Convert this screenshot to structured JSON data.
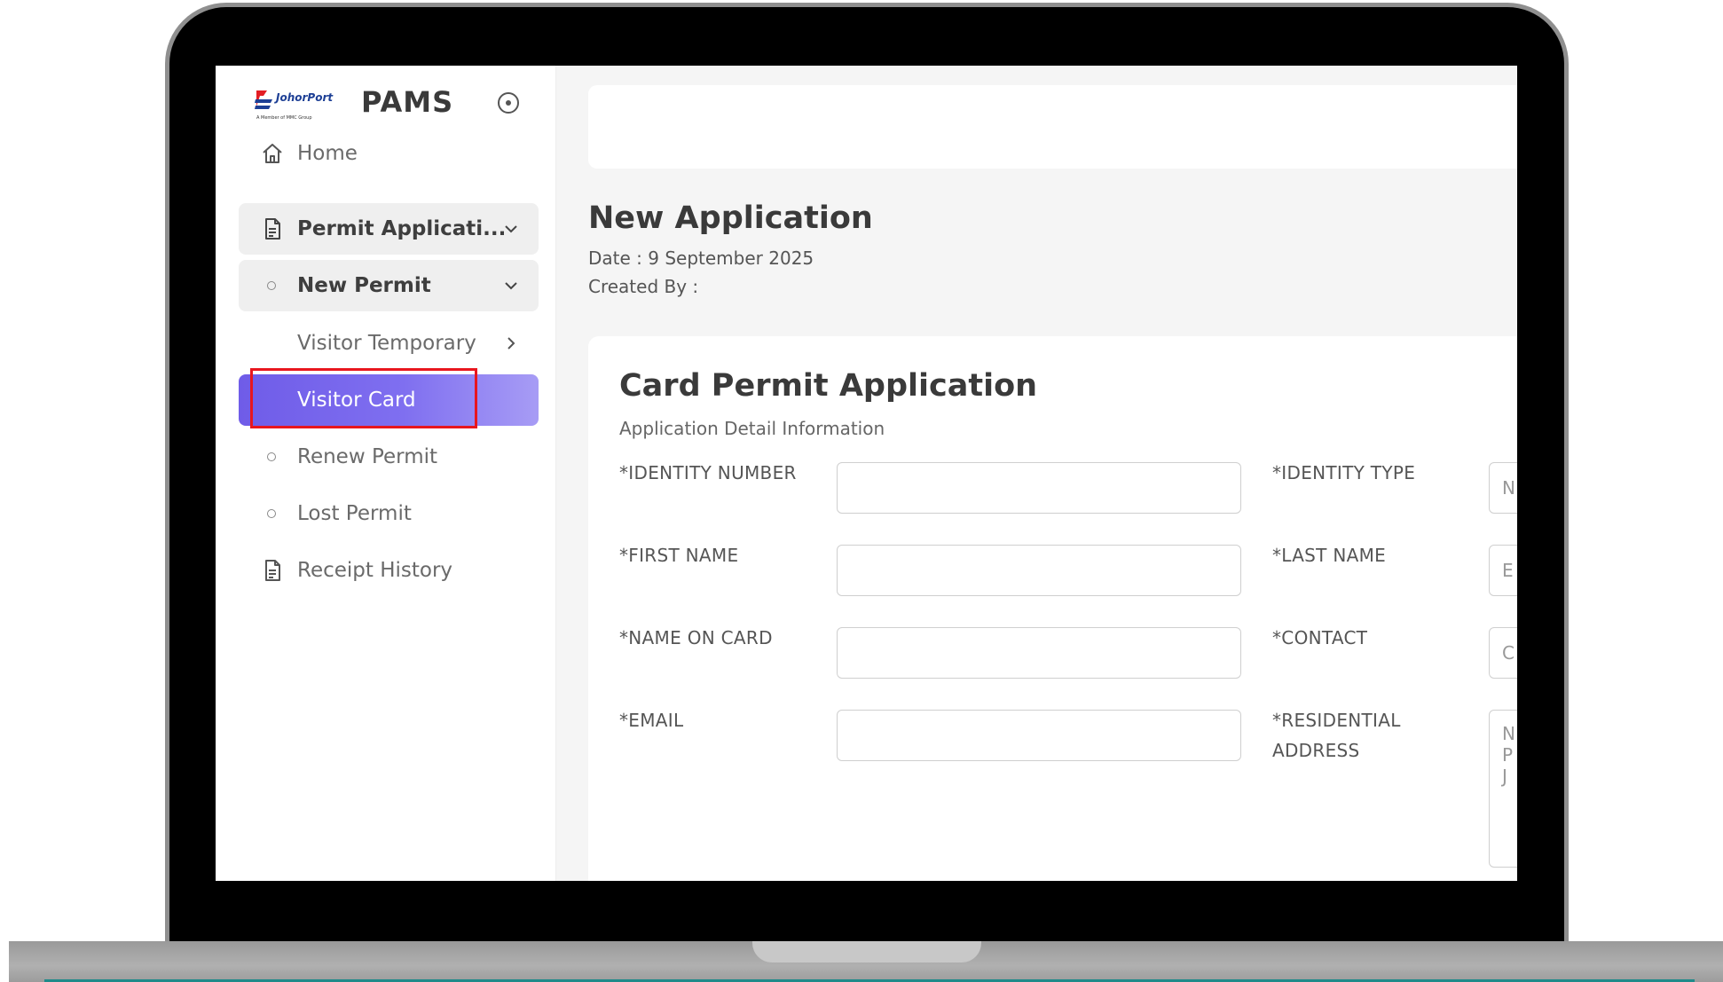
{
  "app": {
    "brand": "PAMS",
    "logo_text": "JohorPort",
    "logo_sub": "A Member of MMC Group"
  },
  "sidebar": {
    "items": [
      {
        "label": "Home",
        "icon": "home-icon"
      },
      {
        "label": "Permit Applicati...",
        "icon": "document-icon"
      },
      {
        "label": "New Permit",
        "icon": "circle-bullet-icon"
      },
      {
        "label": "Visitor Temporary",
        "icon": "chevron-right-icon"
      },
      {
        "label": "Visitor Card",
        "icon": ""
      },
      {
        "label": "Renew Permit",
        "icon": "circle-bullet-icon"
      },
      {
        "label": "Lost Permit",
        "icon": "circle-bullet-icon"
      },
      {
        "label": "Receipt History",
        "icon": "document-icon"
      }
    ]
  },
  "header": {
    "title": "New Application",
    "date": "Date : 9 September 2025",
    "created_by": "Created By :"
  },
  "form": {
    "title": "Card Permit Application",
    "subtitle": "Application Detail Information",
    "fields": {
      "identity_number": {
        "label": "*IDENTITY NUMBER",
        "value": ""
      },
      "identity_type": {
        "label": "*IDENTITY TYPE",
        "placeholder": "N"
      },
      "first_name": {
        "label": "*FIRST NAME",
        "value": ""
      },
      "last_name": {
        "label": "*LAST NAME",
        "placeholder": "E"
      },
      "name_on_card": {
        "label": "*NAME ON CARD",
        "value": ""
      },
      "contact": {
        "label": "*CONTACT",
        "placeholder": "C"
      },
      "email": {
        "label": "*EMAIL",
        "value": ""
      },
      "residential_address": {
        "label_line1": "*RESIDENTIAL",
        "label_line2": "ADDRESS",
        "placeholder": "N\nP\nJ"
      }
    }
  },
  "colors": {
    "accent": "#6f5ce8",
    "highlight_box": "#e8161e",
    "logo_red": "#e31e24",
    "logo_blue": "#1d3f95"
  }
}
